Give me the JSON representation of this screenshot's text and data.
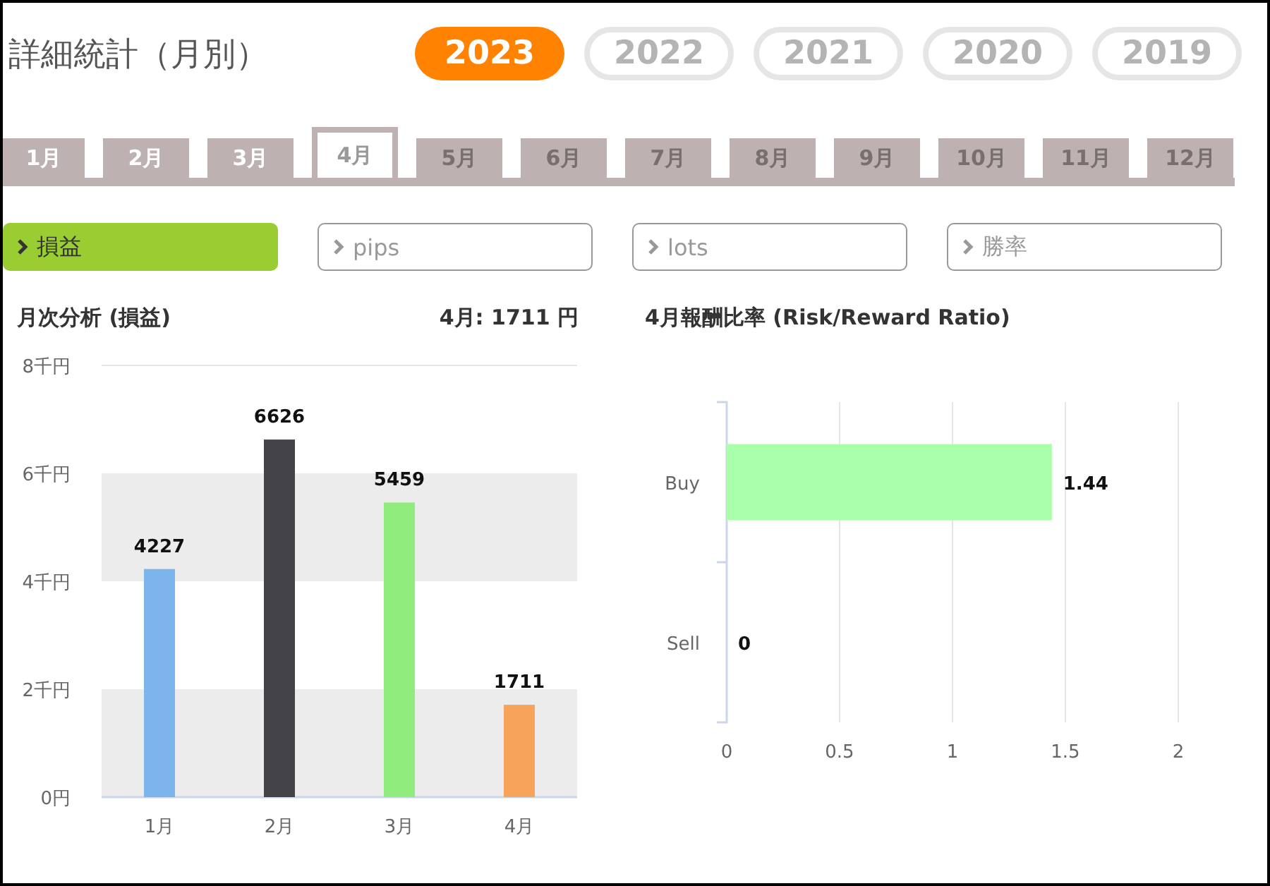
{
  "title": "詳細統計（月別）",
  "years": [
    {
      "label": "2023",
      "selected": true
    },
    {
      "label": "2022",
      "selected": false
    },
    {
      "label": "2021",
      "selected": false
    },
    {
      "label": "2020",
      "selected": false
    },
    {
      "label": "2019",
      "selected": false
    }
  ],
  "months": [
    {
      "label": "1月",
      "selected": false,
      "disabled": false
    },
    {
      "label": "2月",
      "selected": false,
      "disabled": false
    },
    {
      "label": "3月",
      "selected": false,
      "disabled": false
    },
    {
      "label": "4月",
      "selected": true,
      "disabled": false
    },
    {
      "label": "5月",
      "selected": false,
      "disabled": true
    },
    {
      "label": "6月",
      "selected": false,
      "disabled": true
    },
    {
      "label": "7月",
      "selected": false,
      "disabled": true
    },
    {
      "label": "8月",
      "selected": false,
      "disabled": true
    },
    {
      "label": "9月",
      "selected": false,
      "disabled": true
    },
    {
      "label": "10月",
      "selected": false,
      "disabled": true
    },
    {
      "label": "11月",
      "selected": false,
      "disabled": true
    },
    {
      "label": "12月",
      "selected": false,
      "disabled": true
    }
  ],
  "metrics": [
    {
      "label": "損益",
      "selected": true
    },
    {
      "label": "pips",
      "selected": false
    },
    {
      "label": "lots",
      "selected": false
    },
    {
      "label": "勝率",
      "selected": false
    }
  ],
  "monthly_chart": {
    "heading": "月次分析 (損益)",
    "summary": "4月:  1711 円",
    "chart_data": {
      "type": "bar",
      "categories": [
        "1月",
        "2月",
        "3月",
        "4月"
      ],
      "series": [
        {
          "color": "#7cb5ec",
          "values": [
            4.227,
            null,
            null,
            null
          ]
        },
        {
          "color": "#434348",
          "values": [
            null,
            6.626,
            null,
            null
          ]
        },
        {
          "color": "#90ed7d",
          "values": [
            null,
            null,
            5.459,
            null
          ]
        },
        {
          "color": "#f7a35c",
          "values": [
            null,
            null,
            null,
            1.711
          ]
        }
      ],
      "stacked": true,
      "ylim": [
        0,
        8
      ],
      "yticks": [
        {
          "value": 0,
          "label": "0円"
        },
        {
          "value": 2,
          "label": "2千円"
        },
        {
          "value": 4,
          "label": "4千円"
        },
        {
          "value": 6,
          "label": "6千円"
        },
        {
          "value": 8,
          "label": "8千円"
        }
      ],
      "value_labels": [
        "4227",
        "6626",
        "5459",
        "1711"
      ]
    }
  },
  "ratio_chart": {
    "heading": "4月報酬比率 (Risk/Reward Ratio)",
    "chart_data": {
      "type": "bar",
      "orientation": "horizontal",
      "categories": [
        "Buy",
        "Sell"
      ],
      "series": [
        {
          "color": "#aaffaa",
          "values": [
            1.44,
            0
          ]
        }
      ],
      "xlim": [
        0,
        2
      ],
      "xticks": [
        0,
        0.5,
        1,
        1.5,
        2
      ],
      "grid": true,
      "data_labels": true
    }
  }
}
